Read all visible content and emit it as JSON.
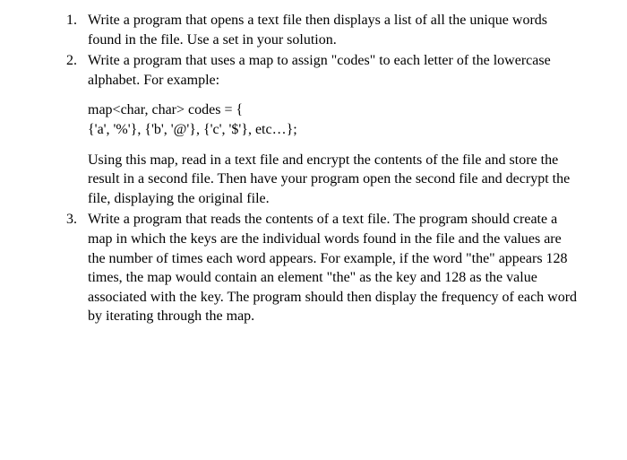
{
  "items": [
    {
      "intro": "Write a program that opens a text file then displays a list of all the unique words found in the file. Use a set in your solution."
    },
    {
      "intro": "Write a program that uses a map to assign \"codes\" to each letter of the lowercase alphabet. For example:",
      "code1": "map<char, char> codes = {",
      "code2": " {'a', '%'}, {'b', '@'}, {'c', '$'}, etc…};",
      "after": "Using this map, read in a text file and encrypt the contents of the file and store the result in a second file. Then have your program open the second file and decrypt the file, displaying the original file."
    },
    {
      "intro": "Write a program that reads the contents of a text file. The program should create a map in which the keys are the individual words found in the file and the values are the number of times each word appears. For example, if the word \"the\" appears 128 times, the map would contain an element \"the\" as the key and 128 as the value associated with the key. The program should then display the frequency of each word by iterating through the map."
    }
  ]
}
